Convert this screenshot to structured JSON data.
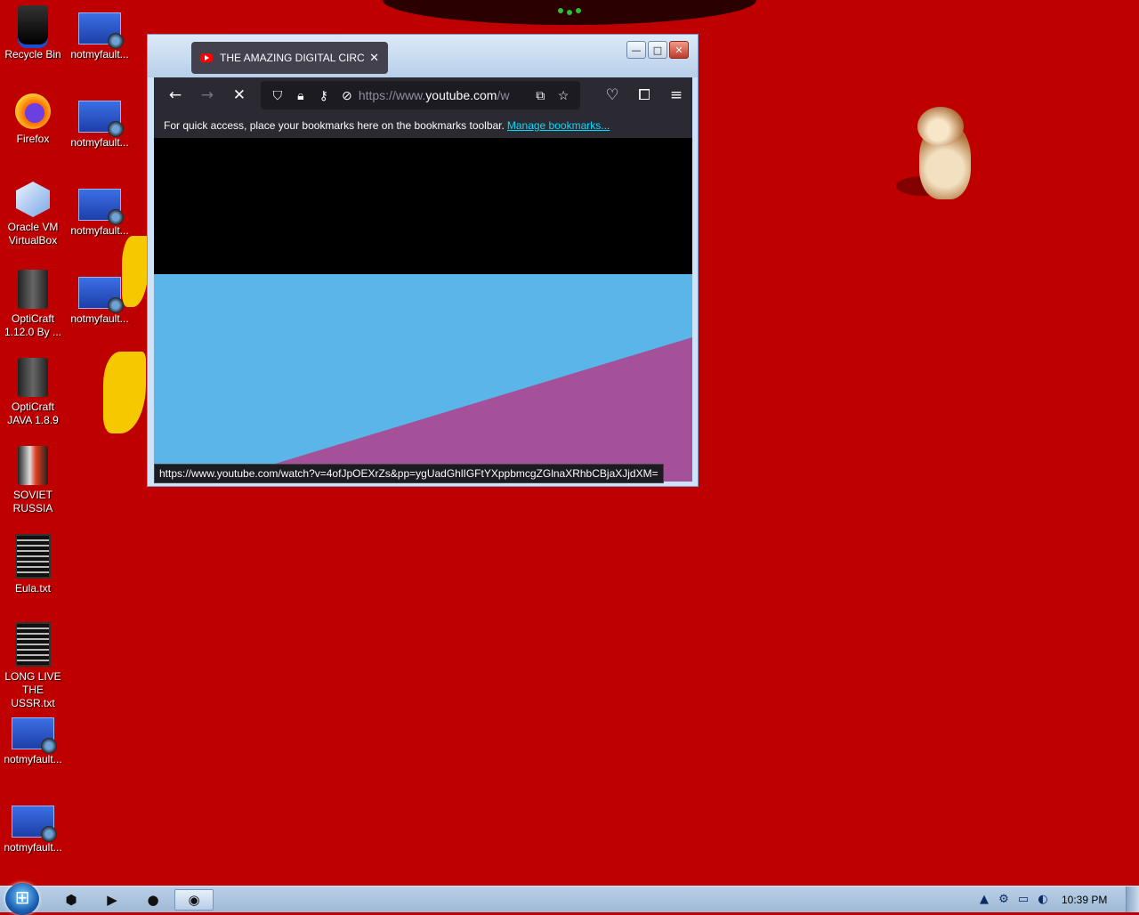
{
  "desktop": {
    "icons": [
      {
        "label": "Recycle Bin",
        "icon": "recycle-bin-icon"
      },
      {
        "label": "notmyfault...",
        "icon": "notmyfault-icon"
      },
      {
        "label": "Firefox",
        "icon": "firefox-icon"
      },
      {
        "label": "notmyfault...",
        "icon": "notmyfault-icon"
      },
      {
        "label": "Oracle VM VirtualBox",
        "icon": "virtualbox-icon"
      },
      {
        "label": "notmyfault...",
        "icon": "notmyfault-icon"
      },
      {
        "label": "OptiCraft 1.12.0 By ...",
        "icon": "opticraft-icon"
      },
      {
        "label": "notmyfault...",
        "icon": "notmyfault-icon"
      },
      {
        "label": "OptiCraft JAVA 1.8.9",
        "icon": "opticraft-java-icon"
      },
      {
        "label": "SOVIET RUSSIA",
        "icon": "soviet-russia-icon"
      },
      {
        "label": "Eula.txt",
        "icon": "text-file-icon"
      },
      {
        "label": "LONG LIVE THE USSR.txt",
        "icon": "text-file-icon"
      },
      {
        "label": "notmyfault...",
        "icon": "notmyfault-icon"
      },
      {
        "label": "notmyfault...",
        "icon": "notmyfault-icon"
      }
    ]
  },
  "browser": {
    "tab_title": "THE AMAZING DIGITAL CIRCUS",
    "tab_close": "✕",
    "url_prefix": "https://www.",
    "url_domain": "youtube.com",
    "url_suffix": "/w",
    "bookmarks_message": "For quick access, place your bookmarks here on the bookmarks toolbar.",
    "manage_bookmarks": "Manage bookmarks...",
    "status_url": "https://www.youtube.com/watch?v=4ofJpOEXrZs&pp=ygUadGhlIGFtYXppbmcgZGlnaXRhbCBjaXJjdXM="
  },
  "taskbar": {
    "clock": "10:39 PM"
  },
  "colors": {
    "desktop_bg": "#bf0000",
    "sky_blue": "#5ab6e8",
    "magenta_floor": "#a4519a"
  }
}
